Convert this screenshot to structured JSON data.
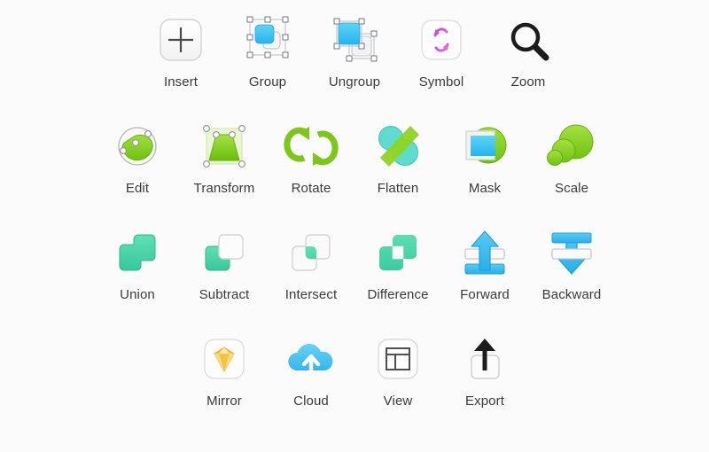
{
  "palette": {
    "background_color": "#fbfbfb",
    "label_color": "#3a3a3c",
    "accent_colors": {
      "blue": "#35c0f0",
      "green": "#8fd620",
      "teal": "#4bd6a8",
      "magenta": "#d84fd8",
      "yellow": "#f5c33b",
      "grey_outline": "#c8c8c8",
      "white_tile": "#fcfcfc"
    },
    "rows": [
      {
        "row_index": 0,
        "items": [
          {
            "label": "Insert",
            "icon": "plus-square-icon"
          },
          {
            "label": "Group",
            "icon": "group-selection-icon"
          },
          {
            "label": "Ungroup",
            "icon": "ungroup-selection-icon"
          },
          {
            "label": "Symbol",
            "icon": "symbol-refresh-icon"
          },
          {
            "label": "Zoom",
            "icon": "magnifier-icon"
          }
        ]
      },
      {
        "row_index": 1,
        "items": [
          {
            "label": "Edit",
            "icon": "edit-vector-points-icon"
          },
          {
            "label": "Transform",
            "icon": "transform-trapezoid-icon"
          },
          {
            "label": "Rotate",
            "icon": "rotate-arrows-icon"
          },
          {
            "label": "Flatten",
            "icon": "flatten-circles-icon"
          },
          {
            "label": "Mask",
            "icon": "mask-square-circle-icon"
          },
          {
            "label": "Scale",
            "icon": "scale-circles-icon"
          }
        ]
      },
      {
        "row_index": 2,
        "items": [
          {
            "label": "Union",
            "icon": "boolean-union-icon"
          },
          {
            "label": "Subtract",
            "icon": "boolean-subtract-icon"
          },
          {
            "label": "Intersect",
            "icon": "boolean-intersect-icon"
          },
          {
            "label": "Difference",
            "icon": "boolean-difference-icon"
          },
          {
            "label": "Forward",
            "icon": "bring-forward-arrow-icon"
          },
          {
            "label": "Backward",
            "icon": "send-backward-arrow-icon"
          }
        ]
      },
      {
        "row_index": 3,
        "items": [
          {
            "label": "Mirror",
            "icon": "sketch-diamond-icon"
          },
          {
            "label": "Cloud",
            "icon": "cloud-upload-icon"
          },
          {
            "label": "View",
            "icon": "layout-panel-icon"
          },
          {
            "label": "Export",
            "icon": "export-upload-icon"
          }
        ]
      }
    ]
  }
}
